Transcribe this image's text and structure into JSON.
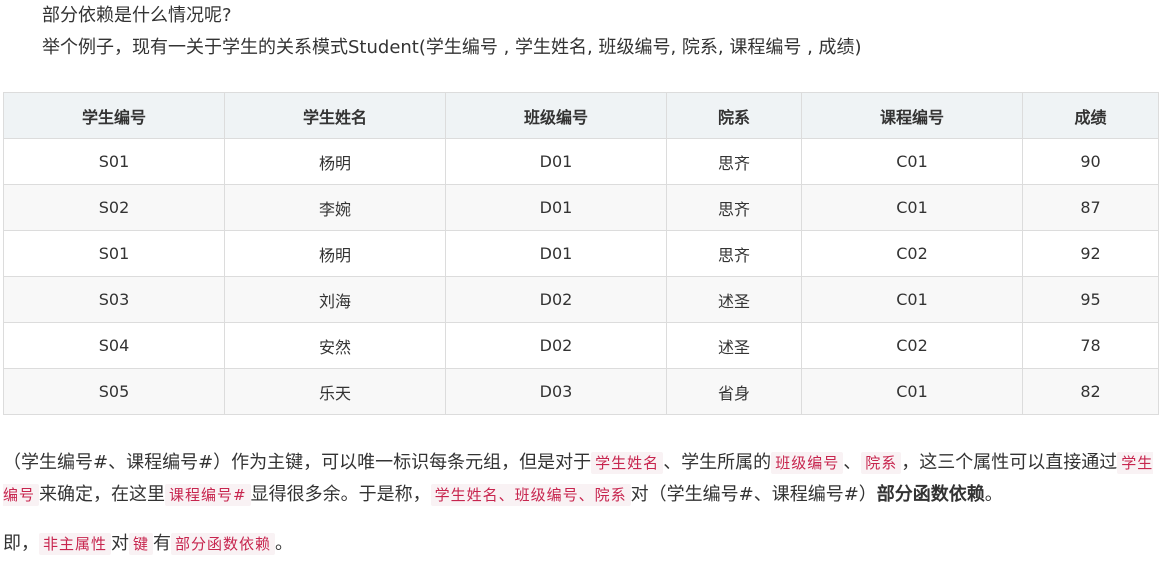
{
  "intro": {
    "line1": "部分依赖是什么情况呢?",
    "line2": "举个例子，现有一关于学生的关系模式Student(学生编号 , 学生姓名, 班级编号, 院系, 课程编号 , 成绩)"
  },
  "table": {
    "headers": [
      "学生编号",
      "学生姓名",
      "班级编号",
      "院系",
      "课程编号",
      "成绩"
    ],
    "rows": [
      [
        "S01",
        "杨明",
        "D01",
        "思齐",
        "C01",
        "90"
      ],
      [
        "S02",
        "李婉",
        "D01",
        "思齐",
        "C01",
        "87"
      ],
      [
        "S01",
        "杨明",
        "D01",
        "思齐",
        "C02",
        "92"
      ],
      [
        "S03",
        "刘海",
        "D02",
        "述圣",
        "C01",
        "95"
      ],
      [
        "S04",
        "安然",
        "D02",
        "述圣",
        "C02",
        "78"
      ],
      [
        "S05",
        "乐天",
        "D03",
        "省身",
        "C01",
        "82"
      ]
    ]
  },
  "explain": {
    "t1": "（学生编号#、课程编号#）作为主键，可以唯一标识每条元组，但是对于",
    "c1": "学生姓名",
    "t2": "、学生所属的",
    "c2": "班级编号",
    "t3": "、",
    "c3": "院系",
    "t4": "，这三个属性可以直接通过",
    "c4": "学生编号",
    "t5": "来确定，在这里",
    "c5": "课程编号#",
    "t6": "显得很多余。于是称，",
    "c6": "学生姓名、班级编号、院系",
    "t7": "对（学生编号#、课程编号#）",
    "strong": "部分函数依赖",
    "t8": "。"
  },
  "conclusion": {
    "t1": "即，",
    "c1": "非主属性",
    "t2": "对",
    "c2": "键",
    "t3": "有",
    "c3": "部分函数依赖",
    "t4": "。"
  }
}
